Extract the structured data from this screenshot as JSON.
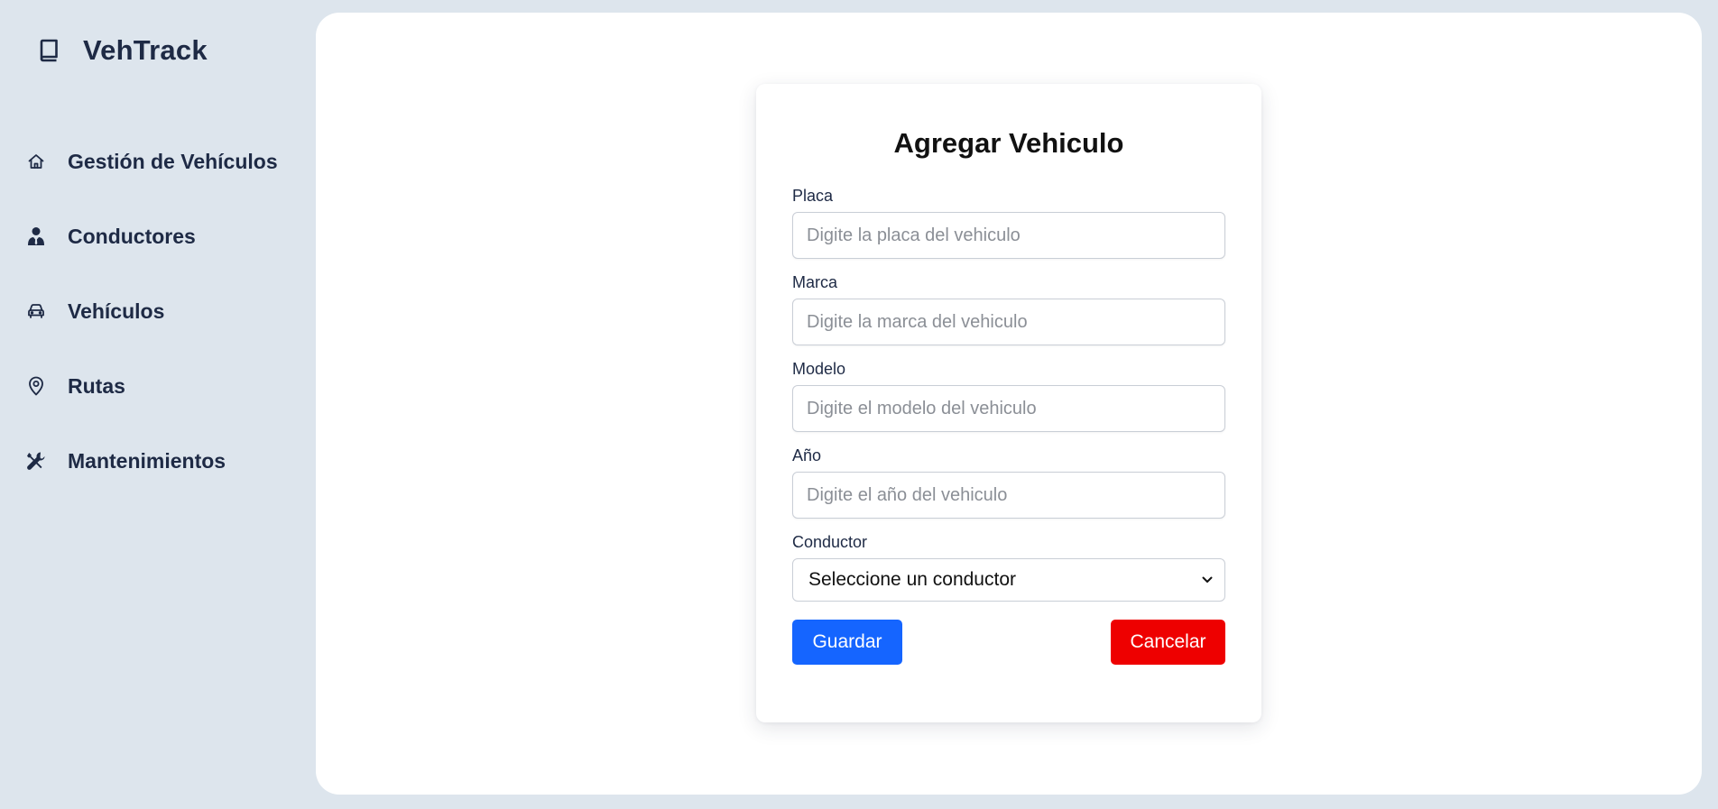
{
  "app": {
    "brand": "VehTrack",
    "brand_icon": "book-icon"
  },
  "sidebar": {
    "items": [
      {
        "label": "Gestión de Vehículos",
        "icon": "home-icon"
      },
      {
        "label": "Conductores",
        "icon": "user-tie-icon"
      },
      {
        "label": "Vehículos",
        "icon": "car-icon"
      },
      {
        "label": "Rutas",
        "icon": "map-pin-icon"
      },
      {
        "label": "Mantenimientos",
        "icon": "tools-icon"
      }
    ]
  },
  "form": {
    "title": "Agregar Vehiculo",
    "fields": {
      "placa": {
        "label": "Placa",
        "placeholder": "Digite la placa del vehiculo",
        "value": ""
      },
      "marca": {
        "label": "Marca",
        "placeholder": "Digite la marca del vehiculo",
        "value": ""
      },
      "modelo": {
        "label": "Modelo",
        "placeholder": "Digite el modelo del vehiculo",
        "value": ""
      },
      "anio": {
        "label": "Año",
        "placeholder": "Digite el año del vehiculo",
        "value": ""
      },
      "conductor": {
        "label": "Conductor",
        "selected": "Seleccione un conductor"
      }
    },
    "save_label": "Guardar",
    "cancel_label": "Cancelar"
  },
  "colors": {
    "background": "#dde5ed",
    "panel": "#ffffff",
    "text_primary": "#1e2a45",
    "save_button": "#1565ff",
    "cancel_button": "#ee0000"
  }
}
